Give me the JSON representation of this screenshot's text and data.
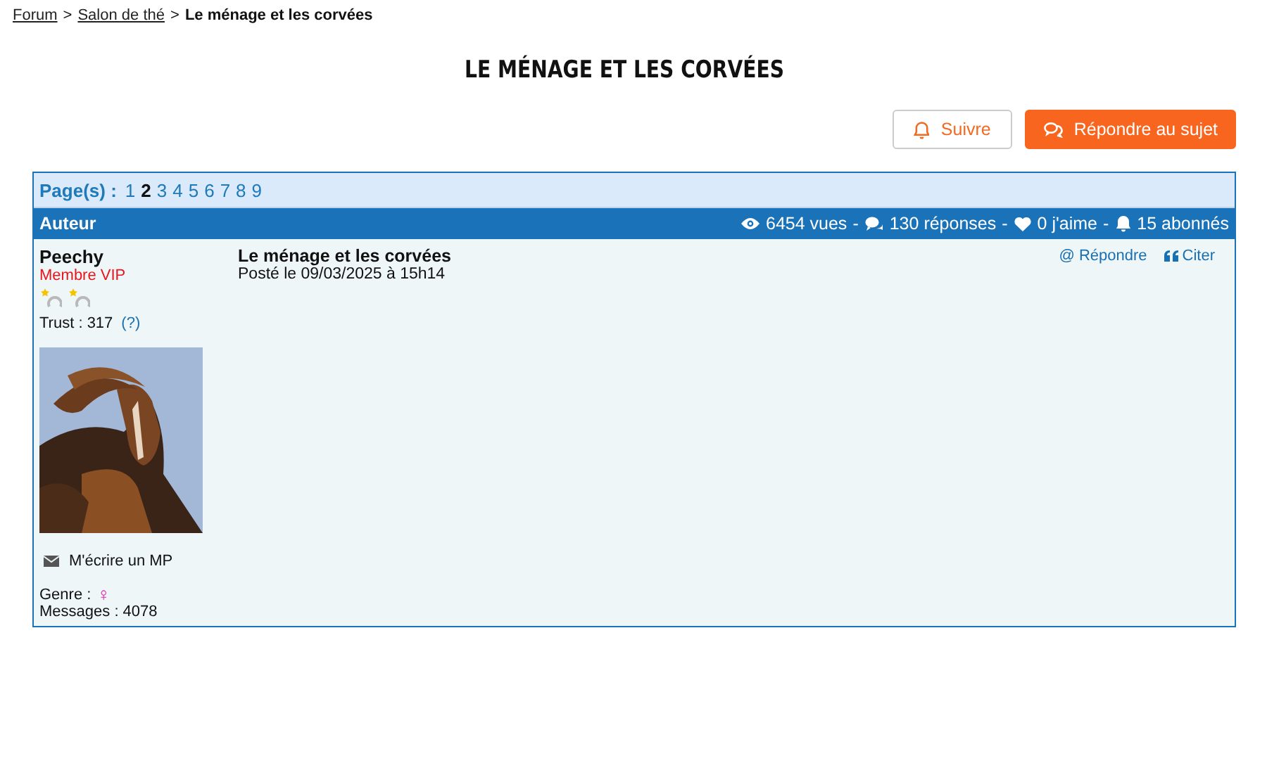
{
  "breadcrumb": [
    {
      "label": "Forum",
      "link": true
    },
    {
      "label": "Salon de thé",
      "link": true
    },
    {
      "label": "Le ménage et les corvées",
      "link": false
    }
  ],
  "breadcrumb_separator": ">",
  "title": "LE MÉNAGE ET LES CORVÉES",
  "actions": [
    {
      "kind": "follow",
      "label": "Suivre"
    },
    {
      "kind": "reply",
      "label": "Répondre au sujet"
    }
  ],
  "pagination": {
    "label": "Page(s) :",
    "pages": [
      {
        "label": "1",
        "selected": false
      },
      {
        "label": "2",
        "selected": true
      },
      {
        "label": "3",
        "selected": false
      },
      {
        "label": "4",
        "selected": false
      },
      {
        "label": "5",
        "selected": false
      },
      {
        "label": "6",
        "selected": false
      },
      {
        "label": "7",
        "selected": false
      },
      {
        "label": "8",
        "selected": false
      },
      {
        "label": "9",
        "selected": false
      }
    ]
  },
  "header": {
    "author_label": "Auteur",
    "stats": [
      {
        "kind": "views",
        "text": "6454 vues"
      },
      {
        "kind": "replies",
        "text": "130 réponses"
      },
      {
        "kind": "likes",
        "text": "0 j'aime"
      },
      {
        "kind": "subscribers",
        "text": "15 abonnés"
      }
    ],
    "separator": "-"
  },
  "post": {
    "author": {
      "name": "Peechy",
      "rank": "Membre VIP",
      "trust": "Trust : 317",
      "trust_help": "(?)",
      "message_link": "M'écrire un MP",
      "gender_label": "Genre :",
      "gender_symbol": "♀",
      "messages": "Messages : 4078"
    },
    "title": "Le ménage et les corvées",
    "date": "Posté le 09/03/2025 à 15h14",
    "actions": [
      {
        "kind": "mention",
        "icon": "@",
        "label": "Répondre"
      },
      {
        "kind": "quote",
        "label": "Citer"
      }
    ]
  }
}
